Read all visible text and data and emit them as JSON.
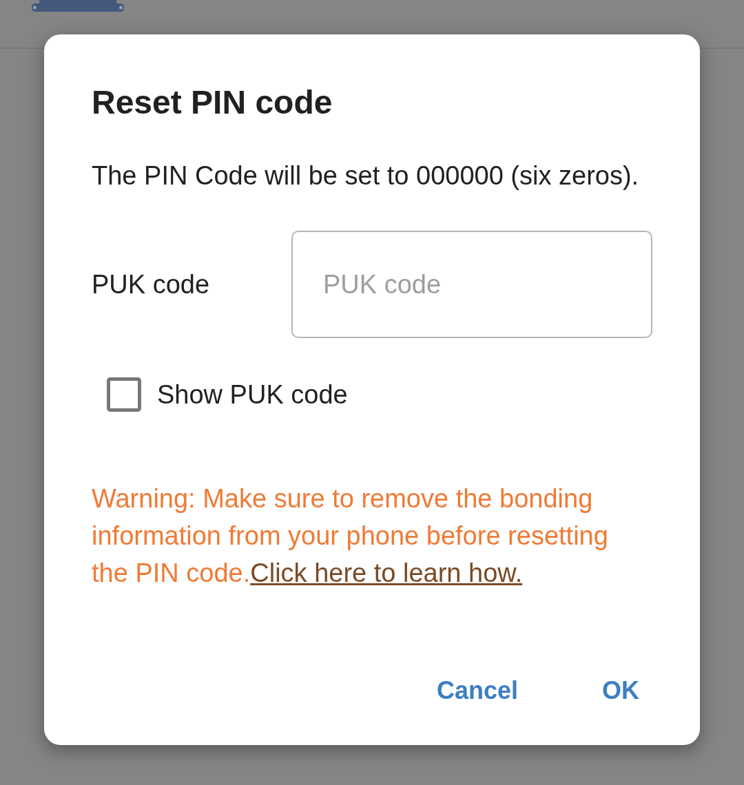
{
  "dialog": {
    "title": "Reset PIN code",
    "message": "The PIN Code will be set to 000000 (six zeros).",
    "fields": [
      {
        "label": "PUK code",
        "placeholder": "PUK code"
      }
    ],
    "checkboxes": [
      {
        "label": "Show PUK code",
        "checked": false
      }
    ],
    "warning": {
      "text": "Warning: Make sure to remove the bonding information from your phone before resetting the PIN code.",
      "link": "Click here to learn how."
    },
    "buttons": [
      "Cancel",
      "OK"
    ]
  }
}
